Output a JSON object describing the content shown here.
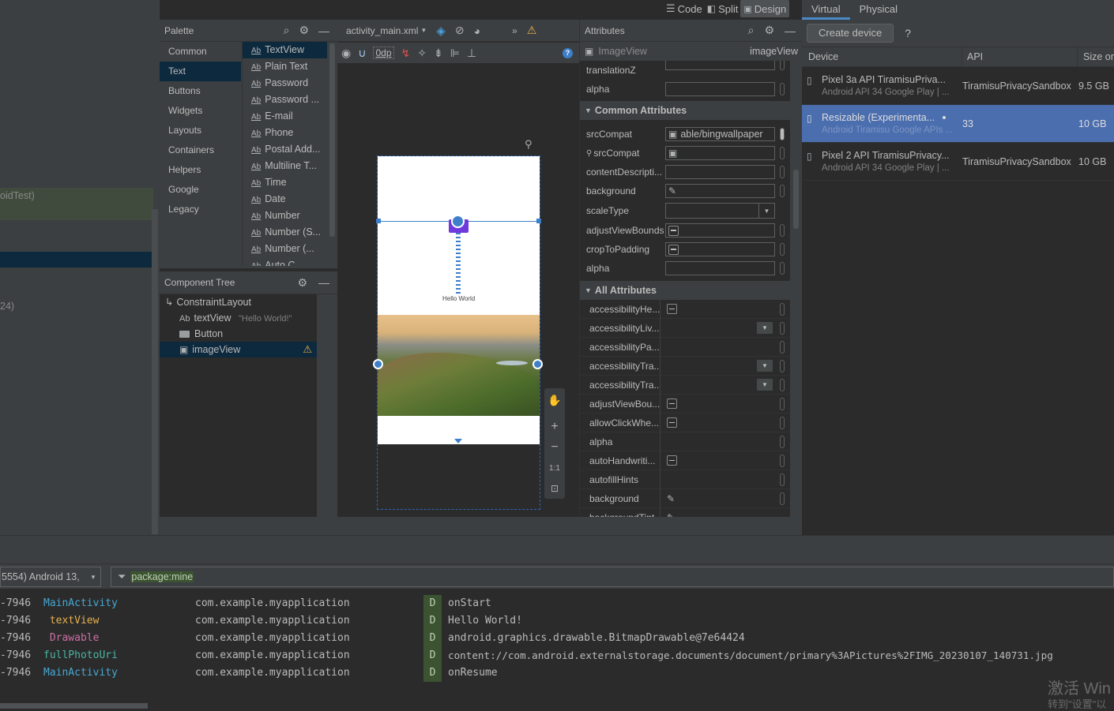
{
  "top_tabs": {
    "code": "Code",
    "split": "Split",
    "design": "Design"
  },
  "device_tabs": {
    "virtual": "Virtual",
    "physical": "Physical"
  },
  "left_strip": {
    "text1": "oidTest)",
    "text2": "24)"
  },
  "palette": {
    "title": "Palette",
    "categories": [
      "Common",
      "Text",
      "Buttons",
      "Widgets",
      "Layouts",
      "Containers",
      "Helpers",
      "Google",
      "Legacy"
    ],
    "selected_category": "Text",
    "items": [
      "TextView",
      "Plain Text",
      "Password",
      "Password ...",
      "E-mail",
      "Phone",
      "Postal Add...",
      "Multiline T...",
      "Time",
      "Date",
      "Number",
      "Number (S...",
      "Number (...",
      "Auto C..."
    ],
    "item_prefix": "Ab"
  },
  "component_tree": {
    "title": "Component Tree",
    "root": "ConstraintLayout",
    "text_view": {
      "name": "textView",
      "value": "\"Hello World!\""
    },
    "button": "Button",
    "image_view": "imageView"
  },
  "editor": {
    "file_tab": "activity_main.xml",
    "margin_value": "0dp",
    "preview_text": "Hello World",
    "zoom_fit": "1:1"
  },
  "attributes": {
    "title": "Attributes",
    "widget_type": "ImageView",
    "widget_id": "imageView",
    "top_rows": [
      {
        "name": "translationZ",
        "value": ""
      },
      {
        "name": "alpha",
        "value": ""
      }
    ],
    "common_header": "Common Attributes",
    "common_rows": {
      "srccompat": {
        "name": "srcCompat",
        "value": "able/bingwallpaper"
      },
      "srccompat_tools": {
        "name": "srcCompat",
        "value": ""
      },
      "content_desc": {
        "name": "contentDescripti...",
        "value": ""
      },
      "background": {
        "name": "background",
        "value": ""
      },
      "scaletype": {
        "name": "scaleType",
        "value": ""
      },
      "adjust_bounds": {
        "name": "adjustViewBounds",
        "value": ""
      },
      "crop_padding": {
        "name": "cropToPadding",
        "value": ""
      },
      "alpha": {
        "name": "alpha",
        "value": ""
      }
    },
    "all_header": "All Attributes",
    "all_rows": [
      "accessibilityHe...",
      "accessibilityLiv...",
      "accessibilityPa...",
      "accessibilityTra...",
      "accessibilityTra...",
      "adjustViewBou...",
      "allowClickWhe...",
      "alpha",
      "autoHandwriti...",
      "autofillHints",
      "background",
      "backgroundTint"
    ]
  },
  "device_manager": {
    "create_button": "Create device",
    "help": "?",
    "columns": {
      "device": "Device",
      "api": "API",
      "size": "Size on"
    },
    "devices": [
      {
        "name": "Pixel 3a API TiramisuPriva...",
        "sub": "Android API 34 Google Play | ...",
        "api": "TiramisuPrivacySandbox",
        "size": "9.5 GB"
      },
      {
        "name": "Resizable (Experimenta...",
        "sub": "Android Tiramisu Google APIs ...",
        "api": "33",
        "size": "10 GB"
      },
      {
        "name": "Pixel 2 API TiramisuPrivacy...",
        "sub": "Android API 34 Google Play | ...",
        "api": "TiramisuPrivacySandbox",
        "size": "10 GB"
      }
    ]
  },
  "logcat": {
    "device_selector": "5554) Android 13,",
    "filter": "package:mine",
    "lines": [
      {
        "pid": "-7946",
        "tag": "MainActivity",
        "tag_color": "#47a7d2",
        "pkg": "com.example.myapplication",
        "level": "D",
        "msg": "onStart"
      },
      {
        "pid": "-7946",
        "tag": " textView",
        "tag_color": "#e8b04d",
        "pkg": "com.example.myapplication",
        "level": "D",
        "msg": "Hello World!"
      },
      {
        "pid": "-7946",
        "tag": " Drawable",
        "tag_color": "#cc6fa5",
        "pkg": "com.example.myapplication",
        "level": "D",
        "msg": "android.graphics.drawable.BitmapDrawable@7e64424"
      },
      {
        "pid": "-7946",
        "tag": "fullPhotoUri",
        "tag_color": "#4ab4a4",
        "pkg": "com.example.myapplication",
        "level": "D",
        "msg": "content://com.android.externalstorage.documents/document/primary%3APictures%2FIMG_20230107_140731.jpg"
      },
      {
        "pid": "-7946",
        "tag": "MainActivity",
        "tag_color": "#47a7d2",
        "pkg": "com.example.myapplication",
        "level": "D",
        "msg": "onResume"
      }
    ]
  },
  "watermark": {
    "line1": "激活 Win",
    "line2": "转到\"设置\"以"
  }
}
